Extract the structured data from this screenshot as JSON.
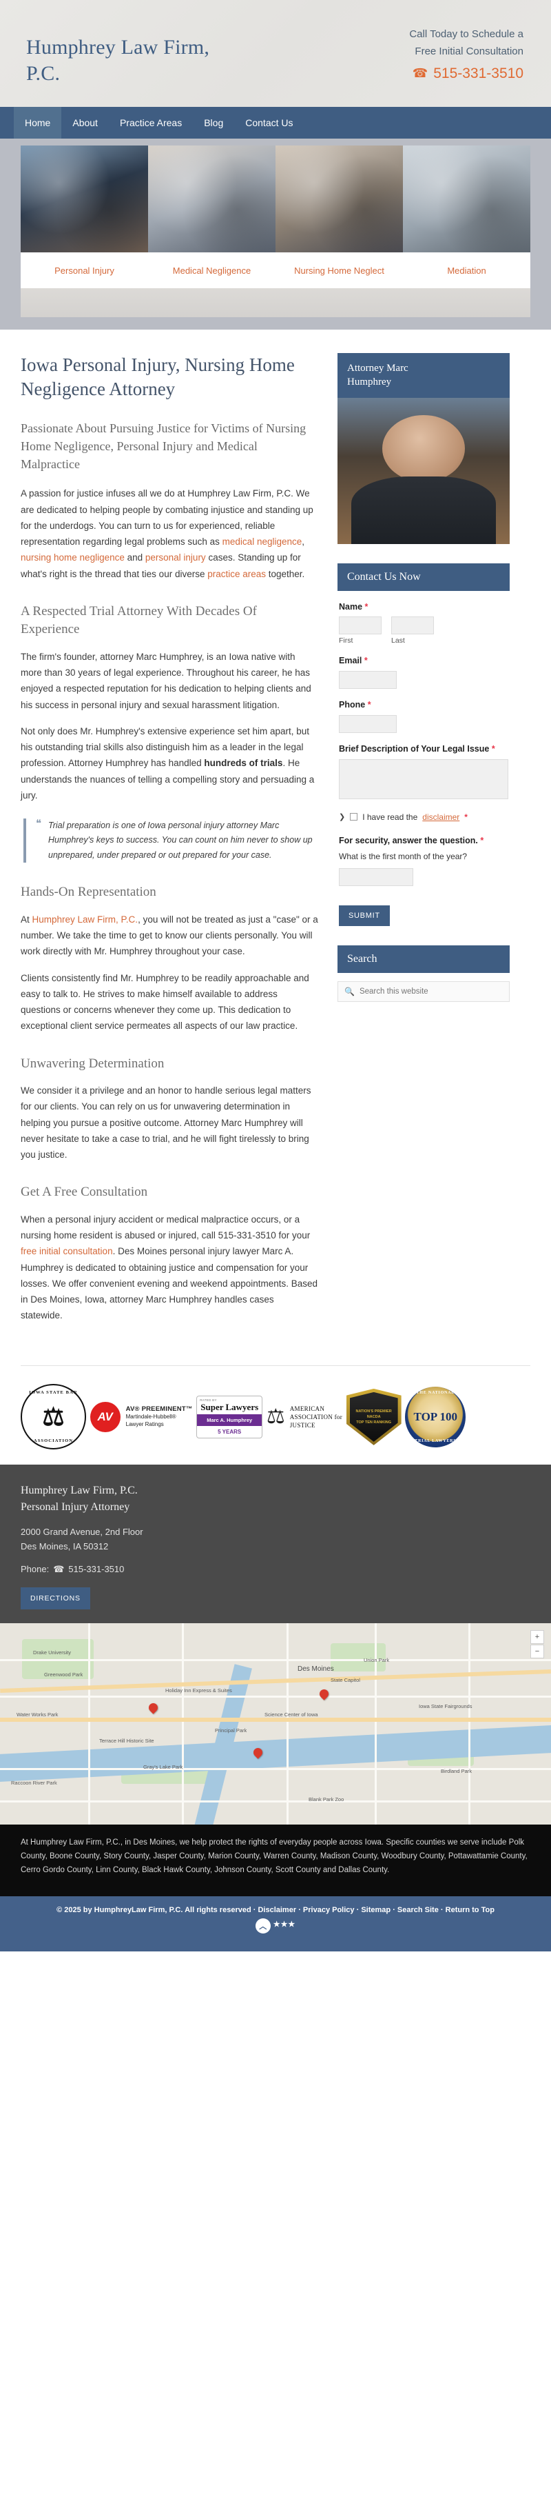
{
  "header": {
    "logo": "Humphrey Law Firm, P.C.",
    "call_line1": "Call Today to Schedule a",
    "call_line2": "Free Initial Consultation",
    "phone": "515-331-3510",
    "phone_icon": "telephone-icon"
  },
  "nav": {
    "items": [
      {
        "label": "Home",
        "active": true
      },
      {
        "label": "About",
        "active": false
      },
      {
        "label": "Practice Areas",
        "active": false
      },
      {
        "label": "Blog",
        "active": false
      },
      {
        "label": "Contact Us",
        "active": false
      }
    ]
  },
  "hero": {
    "tabs": [
      {
        "label": "Personal Injury"
      },
      {
        "label": "Medical Negligence"
      },
      {
        "label": "Nursing Home Neglect"
      },
      {
        "label": "Mediation"
      }
    ]
  },
  "main": {
    "page_title": "Iowa Personal Injury, Nursing Home Negligence Attorney",
    "subtitle": "Passionate About Pursuing Justice for Victims of Nursing Home Negligence, Personal Injury and Medical Malpractice",
    "intro_p1_a": "A passion for justice infuses all we do at Humphrey Law Firm, P.C. We are dedicated to helping people by combating injustice and standing up for the underdogs. You can turn to us for experienced, reliable representation regarding legal problems such as ",
    "intro_link1": "medical negligence",
    "intro_p1_b": ", ",
    "intro_link2": "nursing home negligence",
    "intro_p1_c": " and ",
    "intro_link3": "personal injury",
    "intro_p1_d": " cases. Standing up for what's right is the thread that ties our diverse ",
    "intro_link4": "practice areas",
    "intro_p1_e": " together.",
    "h2_respected": "A Respected Trial Attorney With Decades Of Experience",
    "p_respected_1": "The firm's founder, attorney Marc Humphrey, is an Iowa native with more than 30 years of legal experience. Throughout his career, he has enjoyed a respected reputation for his dedication to helping clients and his success in personal injury and sexual harassment litigation.",
    "p_respected_2a": "Not only does Mr. Humphrey's extensive experience set him apart, but his outstanding trial skills also distinguish him as a leader in the legal profession. Attorney Humphrey has handled ",
    "p_respected_2b": "hundreds of trials",
    "p_respected_2c": ". He understands the nuances of telling a compelling story and persuading a jury.",
    "quote": "Trial preparation is one of Iowa personal injury attorney Marc Humphrey's keys to success. You can count on him never to show up unprepared, under prepared or out prepared for your case.",
    "h2_handson": "Hands-On Representation",
    "p_handson_1a": "At ",
    "p_handson_link": "Humphrey Law Firm, P.C.",
    "p_handson_1b": ", you will not be treated as just a \"case\" or a number. We take the time to get to know our clients personally. You will work directly with Mr. Humphrey throughout your case.",
    "p_handson_2": "Clients consistently find Mr. Humphrey to be readily approachable and easy to talk to. He strives to make himself available to address questions or concerns whenever they come up. This dedication to exceptional client service permeates all aspects of our law practice.",
    "h2_unwavering": "Unwavering Determination",
    "p_unwavering": "We consider it a privilege and an honor to handle serious legal matters for our clients. You can rely on us for unwavering determination in helping you pursue a positive outcome. Attorney Marc Humphrey will never hesitate to take a case to trial, and he will fight tirelessly to bring you justice.",
    "h2_free": "Get A Free Consultation",
    "p_free_a": "When a personal injury accident or medical malpractice occurs, or a nursing home resident is abused or injured, call 515-331-3510 for your ",
    "p_free_link": "free initial consultation",
    "p_free_b": ". Des Moines personal injury lawyer Marc A. Humphrey is dedicated to obtaining justice and compensation for your losses. We offer convenient evening and weekend appointments. Based in Des Moines, Iowa, attorney Marc Humphrey handles cases statewide."
  },
  "sidebar": {
    "attorney_title_line1": "Attorney Marc",
    "attorney_title_line2": "Humphrey",
    "contact_heading": "Contact Us Now",
    "form": {
      "name_label": "Name",
      "first_label": "First",
      "last_label": "Last",
      "email_label": "Email",
      "phone_label": "Phone",
      "brief_label": "Brief Description of Your Legal Issue",
      "disclaimer_prefix": "I have read the",
      "disclaimer_link": "disclaimer",
      "security_label": "For security, answer the question.",
      "security_question": "What is the first month of the year?",
      "submit_label": "SUBMIT",
      "required_mark": "*",
      "name_first_value": "",
      "name_last_value": "",
      "email_value": "",
      "phone_value": "",
      "brief_value": "",
      "answer_value": ""
    },
    "search_heading": "Search",
    "search_placeholder": "Search this website",
    "search_icon": "magnifier-icon"
  },
  "badges": [
    {
      "name": "iowa-state-bar-association",
      "top": "IOWA STATE BAR",
      "bottom": "ASSOCIATION",
      "glyph": "⚖"
    },
    {
      "name": "av-preeminent",
      "mark": "AV",
      "t1": "AV® PREEMINENT™",
      "t2": "Martindale-Hubbell®",
      "t3": "Lawyer Ratings"
    },
    {
      "name": "super-lawyers",
      "rated": "RATED BY",
      "title": "Super Lawyers",
      "person": "Marc A. Humphrey",
      "years": "5 YEARS"
    },
    {
      "name": "american-association-for-justice",
      "l1": "AMERICAN",
      "l2": "ASSOCIATION for",
      "l3": "JUSTICE",
      "glyph": "⚖"
    },
    {
      "name": "nations-premier-shield",
      "l1": "NATION'S PREMIER",
      "l2": "NACDA",
      "l3": "TOP TEN RANKING"
    },
    {
      "name": "national-top-100-trial-lawyers",
      "top": "THE NATIONAL",
      "num": "TOP 100",
      "bottom": "TRIAL LAWYERS"
    }
  ],
  "footer": {
    "firm_line1": "Humphrey Law Firm, P.C.",
    "firm_line2": "Personal Injury Attorney",
    "address_line1": "2000 Grand Avenue, 2nd Floor",
    "address_line2": "Des Moines, IA 50312",
    "phone_label": "Phone:",
    "phone": "515-331-3510",
    "phone_icon": "telephone-icon",
    "directions_label": "DIRECTIONS"
  },
  "map": {
    "city_label": "Des Moines",
    "labels": [
      "Drake University",
      "Principal Park",
      "Water Works Park",
      "State Capitol",
      "Gray's Lake Park",
      "Science Center of Iowa",
      "Iowa State Fairgrounds",
      "Greenwood Park",
      "Blank Park Zoo",
      "Raccoon River Park",
      "Holiday Inn Express & Suites",
      "Terrace Hill Historic Site",
      "Union Park",
      "Birdland Park"
    ],
    "controls": [
      "+",
      "−"
    ]
  },
  "service_area": {
    "text": "At Humphrey Law Firm, P.C., in Des Moines, we help protect the rights of everyday people across Iowa. Specific counties we serve include Polk County, Boone County, Story County, Jasper County, Marion County, Warren County, Madison County, Woodbury County, Pottawattamie County, Cerro Gordo County, Linn County, Black Hawk County, Johnson County, Scott County and Dallas County."
  },
  "copyright": {
    "text": "© 2025 by HumphreyLaw Firm, P.C. All rights reserved ·",
    "links": [
      "Disclaimer",
      "Privacy Policy",
      "Sitemap",
      "Search Site",
      "Return to Top"
    ],
    "separator": "·",
    "to_top_icon": "chevron-up-icon",
    "stars": "★★★"
  },
  "colors": {
    "navy": "#3f5d82",
    "orange": "#d4693a",
    "phone_orange": "#e06a33",
    "required_red": "#e8374a",
    "footer_gray": "#4a4a4a",
    "copyright_blue": "#44618a"
  }
}
